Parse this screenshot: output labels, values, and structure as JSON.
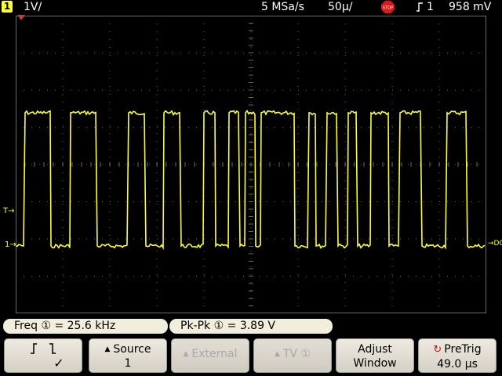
{
  "topbar": {
    "channel_badge": "1",
    "scale": "1V/",
    "sample_rate": "5 MSa/s",
    "timebase": "50µ/",
    "stop_label": "STOP",
    "trigger_source": "1",
    "trigger_level": "958 mV"
  },
  "markers": {
    "trigger_marker": "T",
    "ground_marker": "1",
    "dc_label": "DC"
  },
  "measurements": {
    "freq_label": "Freq",
    "freq_value": "25.6 kHz",
    "pkpk_label": "Pk-Pk",
    "pkpk_value": "3.89  V",
    "channel_ref": "①"
  },
  "softkeys": {
    "slope_check": "✓",
    "source_label": "Source",
    "source_value": "1",
    "external_label": "External",
    "tv_label": "TV",
    "tv_ref": "①",
    "adjust_label": "Adjust",
    "adjust_value": "Window",
    "pretrig_label": "PreTrig",
    "pretrig_value": "49.0 µs"
  },
  "colors": {
    "trace": "#ffff30",
    "grid": "#6a6a6a",
    "softkey_bg": "#e6e2d6"
  }
}
